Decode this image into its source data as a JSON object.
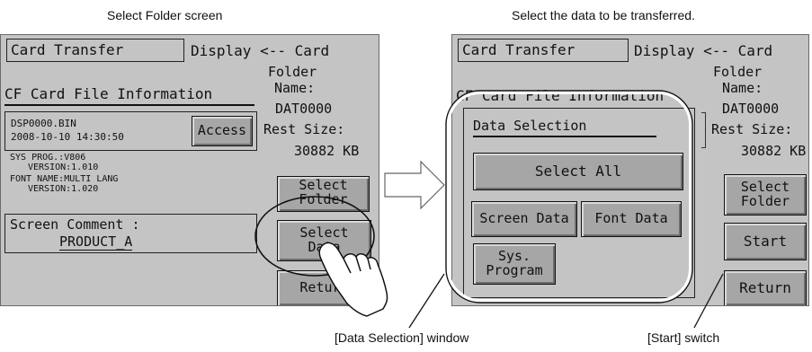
{
  "captions": {
    "left_top": "Select Folder screen",
    "right_top": "Select the data to be transferred.",
    "data_selection_window": "[Data Selection] window",
    "start_switch": "[Start] switch"
  },
  "left_screen": {
    "title": "Card Transfer",
    "mode_label": "Display <-- Card",
    "folder_label": "Folder",
    "name_label": "Name:",
    "folder_name": "DAT0000",
    "rest_size_label": "Rest Size:",
    "rest_size_value": "30882 KB",
    "cf_info_label": "CF Card File Information",
    "file_name": "DSP0000.BIN",
    "file_datetime": "2008-10-10 14:30:50",
    "access_button": "Access",
    "sys_prog_line1": "SYS PROG.:V806",
    "sys_prog_line2": "VERSION:1.010",
    "font_name_line1": "FONT NAME:MULTI LANG",
    "font_name_line2": "VERSION:1.020",
    "screen_comment_label": "Screen Comment :",
    "screen_comment_value": "PRODUCT_A",
    "select_folder_line1": "Select",
    "select_folder_line2": "Folder",
    "select_data_line1": "Select",
    "select_data_line2": "Data",
    "return_button": "Return"
  },
  "right_screen": {
    "title": "Card Transfer",
    "mode_label": "Display <-- Card",
    "folder_label": "Folder",
    "name_label": "Name:",
    "folder_name": "DAT0000",
    "rest_size_label": "Rest Size:",
    "rest_size_value": "30882 KB",
    "cf_info_label": "CF Card File Information",
    "data_selection_title": "Data Selection",
    "select_all_button": "Select All",
    "screen_data_button": "Screen Data",
    "font_data_button": "Font Data",
    "sys_program_line1": "Sys.",
    "sys_program_line2": "Program",
    "select_folder_line1": "Select",
    "select_folder_line2": "Folder",
    "start_button": "Start",
    "return_button": "Return"
  }
}
